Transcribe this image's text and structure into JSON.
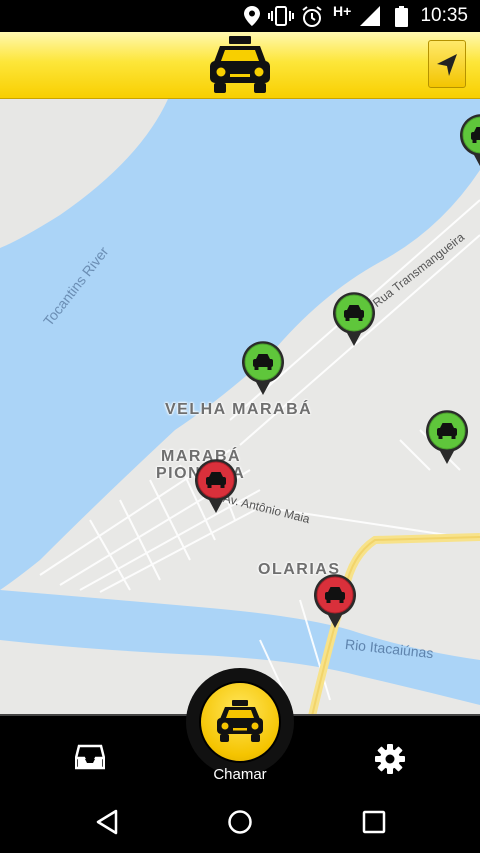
{
  "status_bar": {
    "time": "10:35",
    "network": "H+",
    "icons": [
      "location-icon",
      "vibrate-icon",
      "alarm-icon",
      "signal-icon",
      "battery-icon"
    ]
  },
  "header": {
    "logo_icon": "taxi-icon",
    "locate_button_icon": "navigation-arrow-icon",
    "colors": {
      "yellow": "#f8cf00",
      "yellow_light": "#fff8b0"
    }
  },
  "map": {
    "labels": {
      "river": "Tocantins River",
      "velha_maraba": "VELHA MARABÁ",
      "maraba_line1": "MARABÁ",
      "maraba_line2": "PIONEIRA",
      "olarias": "OLARIAS",
      "av_antonio_maia": "Av. Antônio Maia",
      "rodovia": "Rua Transmangueira",
      "rio_itacaiunas": "Rio Itacaiúnas"
    },
    "markers": [
      {
        "status": "available",
        "color": "#5fc63b"
      },
      {
        "status": "available",
        "color": "#5fc63b"
      },
      {
        "status": "available",
        "color": "#5fc63b"
      },
      {
        "status": "available",
        "color": "#5fc63b"
      },
      {
        "status": "busy",
        "color": "#d9303b"
      },
      {
        "status": "busy",
        "color": "#d9303b"
      }
    ]
  },
  "bottom_bar": {
    "left_icon": "inbox-icon",
    "call_label": "Chamar",
    "right_icon": "gear-icon"
  },
  "nav_bar": {
    "icons": [
      "back-icon",
      "home-icon",
      "recents-icon"
    ]
  }
}
